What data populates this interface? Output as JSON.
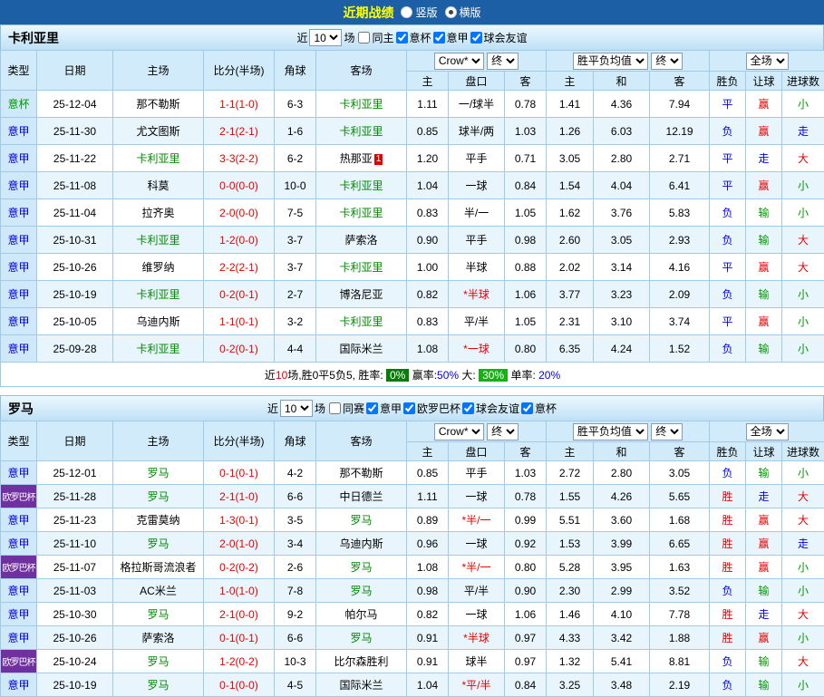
{
  "topbar": {
    "title": "近期战绩",
    "vertical_label": "竖版",
    "horizontal_label": "横版",
    "selected_layout": "横版"
  },
  "palette": {
    "topbar_blue": "#1d5fa5",
    "title_yellow": "#ffff00",
    "win_red": "#e80000",
    "draw_loss_blue": "#0000e8",
    "under_green": "#009900",
    "europa_purple": "#7030a0",
    "focus_team_green": "#008800"
  },
  "sections": [
    {
      "team": "卡利亚里",
      "filter": {
        "prefix": "近",
        "count": "10",
        "suffix": "场",
        "checkboxes": [
          {
            "label": "同主",
            "checked": false
          },
          {
            "label": "意杯",
            "checked": true
          },
          {
            "label": "意甲",
            "checked": true
          },
          {
            "label": "球会友谊",
            "checked": true
          }
        ]
      },
      "columns": {
        "type": "类型",
        "date": "日期",
        "home": "主场",
        "score": "比分(半场)",
        "corner": "角球",
        "away": "客场",
        "odds_source": "Crow*",
        "odds_state": "终",
        "avg_label": "胜平负均值",
        "avg_state": "终",
        "scope": "全场",
        "sub": [
          "主",
          "盘口",
          "客",
          "主",
          "和",
          "客",
          "胜负",
          "让球",
          "进球数"
        ]
      },
      "rows": [
        {
          "type": "意杯",
          "date": "25-12-04",
          "home": "那不勒斯",
          "home_focus": false,
          "score": "1-1(1-0)",
          "corner": "6-3",
          "away": "卡利亚里",
          "away_focus": true,
          "badge": "",
          "odds_home": "1.11",
          "handicap": "一/球半",
          "odds_away": "0.78",
          "avg_home": "1.41",
          "avg_draw": "4.36",
          "avg_away": "7.94",
          "result": "平",
          "handicap_result": "赢",
          "goals": "小"
        },
        {
          "type": "意甲",
          "date": "25-11-30",
          "home": "尤文图斯",
          "home_focus": false,
          "score": "2-1(2-1)",
          "corner": "1-6",
          "away": "卡利亚里",
          "away_focus": true,
          "badge": "",
          "odds_home": "0.85",
          "handicap": "球半/两",
          "odds_away": "1.03",
          "avg_home": "1.26",
          "avg_draw": "6.03",
          "avg_away": "12.19",
          "result": "负",
          "handicap_result": "赢",
          "goals": "走"
        },
        {
          "type": "意甲",
          "date": "25-11-22",
          "home": "卡利亚里",
          "home_focus": true,
          "score": "3-3(2-2)",
          "corner": "6-2",
          "away": "热那亚",
          "away_focus": false,
          "badge": "1",
          "odds_home": "1.20",
          "handicap": "平手",
          "odds_away": "0.71",
          "avg_home": "3.05",
          "avg_draw": "2.80",
          "avg_away": "2.71",
          "result": "平",
          "handicap_result": "走",
          "goals": "大"
        },
        {
          "type": "意甲",
          "date": "25-11-08",
          "home": "科莫",
          "home_focus": false,
          "score": "0-0(0-0)",
          "corner": "10-0",
          "away": "卡利亚里",
          "away_focus": true,
          "badge": "",
          "odds_home": "1.04",
          "handicap": "一球",
          "odds_away": "0.84",
          "avg_home": "1.54",
          "avg_draw": "4.04",
          "avg_away": "6.41",
          "result": "平",
          "handicap_result": "赢",
          "goals": "小"
        },
        {
          "type": "意甲",
          "date": "25-11-04",
          "home": "拉齐奥",
          "home_focus": false,
          "score": "2-0(0-0)",
          "corner": "7-5",
          "away": "卡利亚里",
          "away_focus": true,
          "badge": "",
          "odds_home": "0.83",
          "handicap": "半/一",
          "odds_away": "1.05",
          "avg_home": "1.62",
          "avg_draw": "3.76",
          "avg_away": "5.83",
          "result": "负",
          "handicap_result": "输",
          "goals": "小"
        },
        {
          "type": "意甲",
          "date": "25-10-31",
          "home": "卡利亚里",
          "home_focus": true,
          "score": "1-2(0-0)",
          "corner": "3-7",
          "away": "萨索洛",
          "away_focus": false,
          "badge": "",
          "odds_home": "0.90",
          "handicap": "平手",
          "odds_away": "0.98",
          "avg_home": "2.60",
          "avg_draw": "3.05",
          "avg_away": "2.93",
          "result": "负",
          "handicap_result": "输",
          "goals": "大"
        },
        {
          "type": "意甲",
          "date": "25-10-26",
          "home": "维罗纳",
          "home_focus": false,
          "score": "2-2(2-1)",
          "corner": "3-7",
          "away": "卡利亚里",
          "away_focus": true,
          "badge": "",
          "odds_home": "1.00",
          "handicap": "半球",
          "odds_away": "0.88",
          "avg_home": "2.02",
          "avg_draw": "3.14",
          "avg_away": "4.16",
          "result": "平",
          "handicap_result": "赢",
          "goals": "大"
        },
        {
          "type": "意甲",
          "date": "25-10-19",
          "home": "卡利亚里",
          "home_focus": true,
          "score": "0-2(0-1)",
          "corner": "2-7",
          "away": "博洛尼亚",
          "away_focus": false,
          "badge": "",
          "odds_home": "0.82",
          "handicap": "*半球",
          "odds_away": "1.06",
          "avg_home": "3.77",
          "avg_draw": "3.23",
          "avg_away": "2.09",
          "result": "负",
          "handicap_result": "输",
          "goals": "小"
        },
        {
          "type": "意甲",
          "date": "25-10-05",
          "home": "乌迪内斯",
          "home_focus": false,
          "score": "1-1(0-1)",
          "corner": "3-2",
          "away": "卡利亚里",
          "away_focus": true,
          "badge": "",
          "odds_home": "0.83",
          "handicap": "平/半",
          "odds_away": "1.05",
          "avg_home": "2.31",
          "avg_draw": "3.10",
          "avg_away": "3.74",
          "result": "平",
          "handicap_result": "赢",
          "goals": "小"
        },
        {
          "type": "意甲",
          "date": "25-09-28",
          "home": "卡利亚里",
          "home_focus": true,
          "score": "0-2(0-1)",
          "corner": "4-4",
          "away": "国际米兰",
          "away_focus": false,
          "badge": "",
          "odds_home": "1.08",
          "handicap": "*一球",
          "odds_away": "0.80",
          "avg_home": "6.35",
          "avg_draw": "4.24",
          "avg_away": "1.52",
          "result": "负",
          "handicap_result": "输",
          "goals": "小"
        }
      ],
      "summary": {
        "prefix": "近",
        "count": "10",
        "mid": "场,胜0平5负5, 胜率: ",
        "win_rate": "0%",
        "handicap_label": " 赢率:",
        "handicap_rate": "50%",
        "over_label": " 大: ",
        "over_rate": "30%",
        "single_label": " 单率: ",
        "single_rate": "20%"
      }
    },
    {
      "team": "罗马",
      "filter": {
        "prefix": "近",
        "count": "10",
        "suffix": "场",
        "checkboxes": [
          {
            "label": "同赛",
            "checked": false
          },
          {
            "label": "意甲",
            "checked": true
          },
          {
            "label": "欧罗巴杯",
            "checked": true
          },
          {
            "label": "球会友谊",
            "checked": true
          },
          {
            "label": "意杯",
            "checked": true
          }
        ]
      },
      "columns": {
        "type": "类型",
        "date": "日期",
        "home": "主场",
        "score": "比分(半场)",
        "corner": "角球",
        "away": "客场",
        "odds_source": "Crow*",
        "odds_state": "终",
        "avg_label": "胜平负均值",
        "avg_state": "终",
        "scope": "全场",
        "sub": [
          "主",
          "盘口",
          "客",
          "主",
          "和",
          "客",
          "胜负",
          "让球",
          "进球数"
        ]
      },
      "rows": [
        {
          "type": "意甲",
          "date": "25-12-01",
          "home": "罗马",
          "home_focus": true,
          "score": "0-1(0-1)",
          "corner": "4-2",
          "away": "那不勒斯",
          "away_focus": false,
          "badge": "",
          "odds_home": "0.85",
          "handicap": "平手",
          "odds_away": "1.03",
          "avg_home": "2.72",
          "avg_draw": "2.80",
          "avg_away": "3.05",
          "result": "负",
          "handicap_result": "输",
          "goals": "小"
        },
        {
          "type": "欧罗巴杯",
          "date": "25-11-28",
          "home": "罗马",
          "home_focus": true,
          "score": "2-1(1-0)",
          "corner": "6-6",
          "away": "中日德兰",
          "away_focus": false,
          "badge": "",
          "odds_home": "1.11",
          "handicap": "一球",
          "odds_away": "0.78",
          "avg_home": "1.55",
          "avg_draw": "4.26",
          "avg_away": "5.65",
          "result": "胜",
          "handicap_result": "走",
          "goals": "大"
        },
        {
          "type": "意甲",
          "date": "25-11-23",
          "home": "克雷莫纳",
          "home_focus": false,
          "score": "1-3(0-1)",
          "corner": "3-5",
          "away": "罗马",
          "away_focus": true,
          "badge": "",
          "odds_home": "0.89",
          "handicap": "*半/一",
          "odds_away": "0.99",
          "avg_home": "5.51",
          "avg_draw": "3.60",
          "avg_away": "1.68",
          "result": "胜",
          "handicap_result": "赢",
          "goals": "大"
        },
        {
          "type": "意甲",
          "date": "25-11-10",
          "home": "罗马",
          "home_focus": true,
          "score": "2-0(1-0)",
          "corner": "3-4",
          "away": "乌迪内斯",
          "away_focus": false,
          "badge": "",
          "odds_home": "0.96",
          "handicap": "一球",
          "odds_away": "0.92",
          "avg_home": "1.53",
          "avg_draw": "3.99",
          "avg_away": "6.65",
          "result": "胜",
          "handicap_result": "赢",
          "goals": "走"
        },
        {
          "type": "欧罗巴杯",
          "date": "25-11-07",
          "home": "格拉斯哥流浪者",
          "home_focus": false,
          "score": "0-2(0-2)",
          "corner": "2-6",
          "away": "罗马",
          "away_focus": true,
          "badge": "",
          "odds_home": "1.08",
          "handicap": "*半/一",
          "odds_away": "0.80",
          "avg_home": "5.28",
          "avg_draw": "3.95",
          "avg_away": "1.63",
          "result": "胜",
          "handicap_result": "赢",
          "goals": "小"
        },
        {
          "type": "意甲",
          "date": "25-11-03",
          "home": "AC米兰",
          "home_focus": false,
          "score": "1-0(1-0)",
          "corner": "7-8",
          "away": "罗马",
          "away_focus": true,
          "badge": "",
          "odds_home": "0.98",
          "handicap": "平/半",
          "odds_away": "0.90",
          "avg_home": "2.30",
          "avg_draw": "2.99",
          "avg_away": "3.52",
          "result": "负",
          "handicap_result": "输",
          "goals": "小"
        },
        {
          "type": "意甲",
          "date": "25-10-30",
          "home": "罗马",
          "home_focus": true,
          "score": "2-1(0-0)",
          "corner": "9-2",
          "away": "帕尔马",
          "away_focus": false,
          "badge": "",
          "odds_home": "0.82",
          "handicap": "一球",
          "odds_away": "1.06",
          "avg_home": "1.46",
          "avg_draw": "4.10",
          "avg_away": "7.78",
          "result": "胜",
          "handicap_result": "走",
          "goals": "大"
        },
        {
          "type": "意甲",
          "date": "25-10-26",
          "home": "萨索洛",
          "home_focus": false,
          "score": "0-1(0-1)",
          "corner": "6-6",
          "away": "罗马",
          "away_focus": true,
          "badge": "",
          "odds_home": "0.91",
          "handicap": "*半球",
          "odds_away": "0.97",
          "avg_home": "4.33",
          "avg_draw": "3.42",
          "avg_away": "1.88",
          "result": "胜",
          "handicap_result": "赢",
          "goals": "小"
        },
        {
          "type": "欧罗巴杯",
          "date": "25-10-24",
          "home": "罗马",
          "home_focus": true,
          "score": "1-2(0-2)",
          "corner": "10-3",
          "away": "比尔森胜利",
          "away_focus": false,
          "badge": "",
          "odds_home": "0.91",
          "handicap": "球半",
          "odds_away": "0.97",
          "avg_home": "1.32",
          "avg_draw": "5.41",
          "avg_away": "8.81",
          "result": "负",
          "handicap_result": "输",
          "goals": "大"
        },
        {
          "type": "意甲",
          "date": "25-10-19",
          "home": "罗马",
          "home_focus": true,
          "score": "0-1(0-0)",
          "corner": "4-5",
          "away": "国际米兰",
          "away_focus": false,
          "badge": "",
          "odds_home": "1.04",
          "handicap": "*平/半",
          "odds_away": "0.84",
          "avg_home": "3.25",
          "avg_draw": "3.48",
          "avg_away": "2.19",
          "result": "负",
          "handicap_result": "输",
          "goals": "小"
        }
      ],
      "summary": null
    }
  ]
}
